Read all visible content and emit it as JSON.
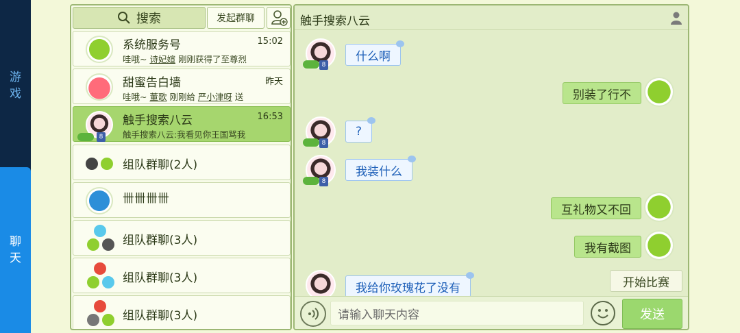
{
  "nav": {
    "games_label": [
      "游",
      "戏"
    ],
    "chat_label": [
      "聊",
      "天"
    ]
  },
  "list": {
    "search_label": "搜索",
    "group_chat_label": "发起群聊",
    "conversations": [
      {
        "name": "系统服务号",
        "time": "15:02",
        "preview_parts": [
          "哇哦~ ",
          "诗妃媗",
          " 刚刚获得了至尊烈"
        ],
        "avatar": "green-monster"
      },
      {
        "name": "甜蜜告白墙",
        "time": "昨天",
        "preview_parts": [
          "哇哦~ ",
          "董歌",
          " 刚刚给 ",
          "严小津呀",
          " 送"
        ],
        "avatar": "red-monster"
      },
      {
        "name": "触手搜索八云",
        "time": "16:53",
        "preview": "触手搜索八云:我看见你王国骂我",
        "avatar": "girl",
        "level": "8",
        "active": true
      },
      {
        "name": "组队群聊(2人)",
        "avatar": "group"
      },
      {
        "name": "卌卌卌卌",
        "avatar": "blue-logo"
      },
      {
        "name": "组队群聊(3人)",
        "avatar": "group"
      },
      {
        "name": "组队群聊(3人)",
        "avatar": "group"
      },
      {
        "name": "组队群聊(3人)",
        "avatar": "group"
      }
    ]
  },
  "chat": {
    "title": "触手搜索八云",
    "messages": [
      {
        "side": "left",
        "text": "什么啊"
      },
      {
        "side": "right",
        "text": "别装了行不"
      },
      {
        "side": "left",
        "text": "?"
      },
      {
        "side": "left",
        "text": "我装什么"
      },
      {
        "side": "right",
        "text": "互礼物又不回"
      },
      {
        "side": "right",
        "text": "我有截图"
      },
      {
        "side": "left",
        "text": "我给你玫瑰花了没有"
      }
    ],
    "level_badge": "8",
    "start_match_label": "开始比赛",
    "input_placeholder": "请输入聊天内容",
    "send_label": "发送"
  },
  "colors": {
    "accent_green": "#9bd86e",
    "nav_dark": "#0d2745",
    "nav_active": "#1a8be6"
  }
}
